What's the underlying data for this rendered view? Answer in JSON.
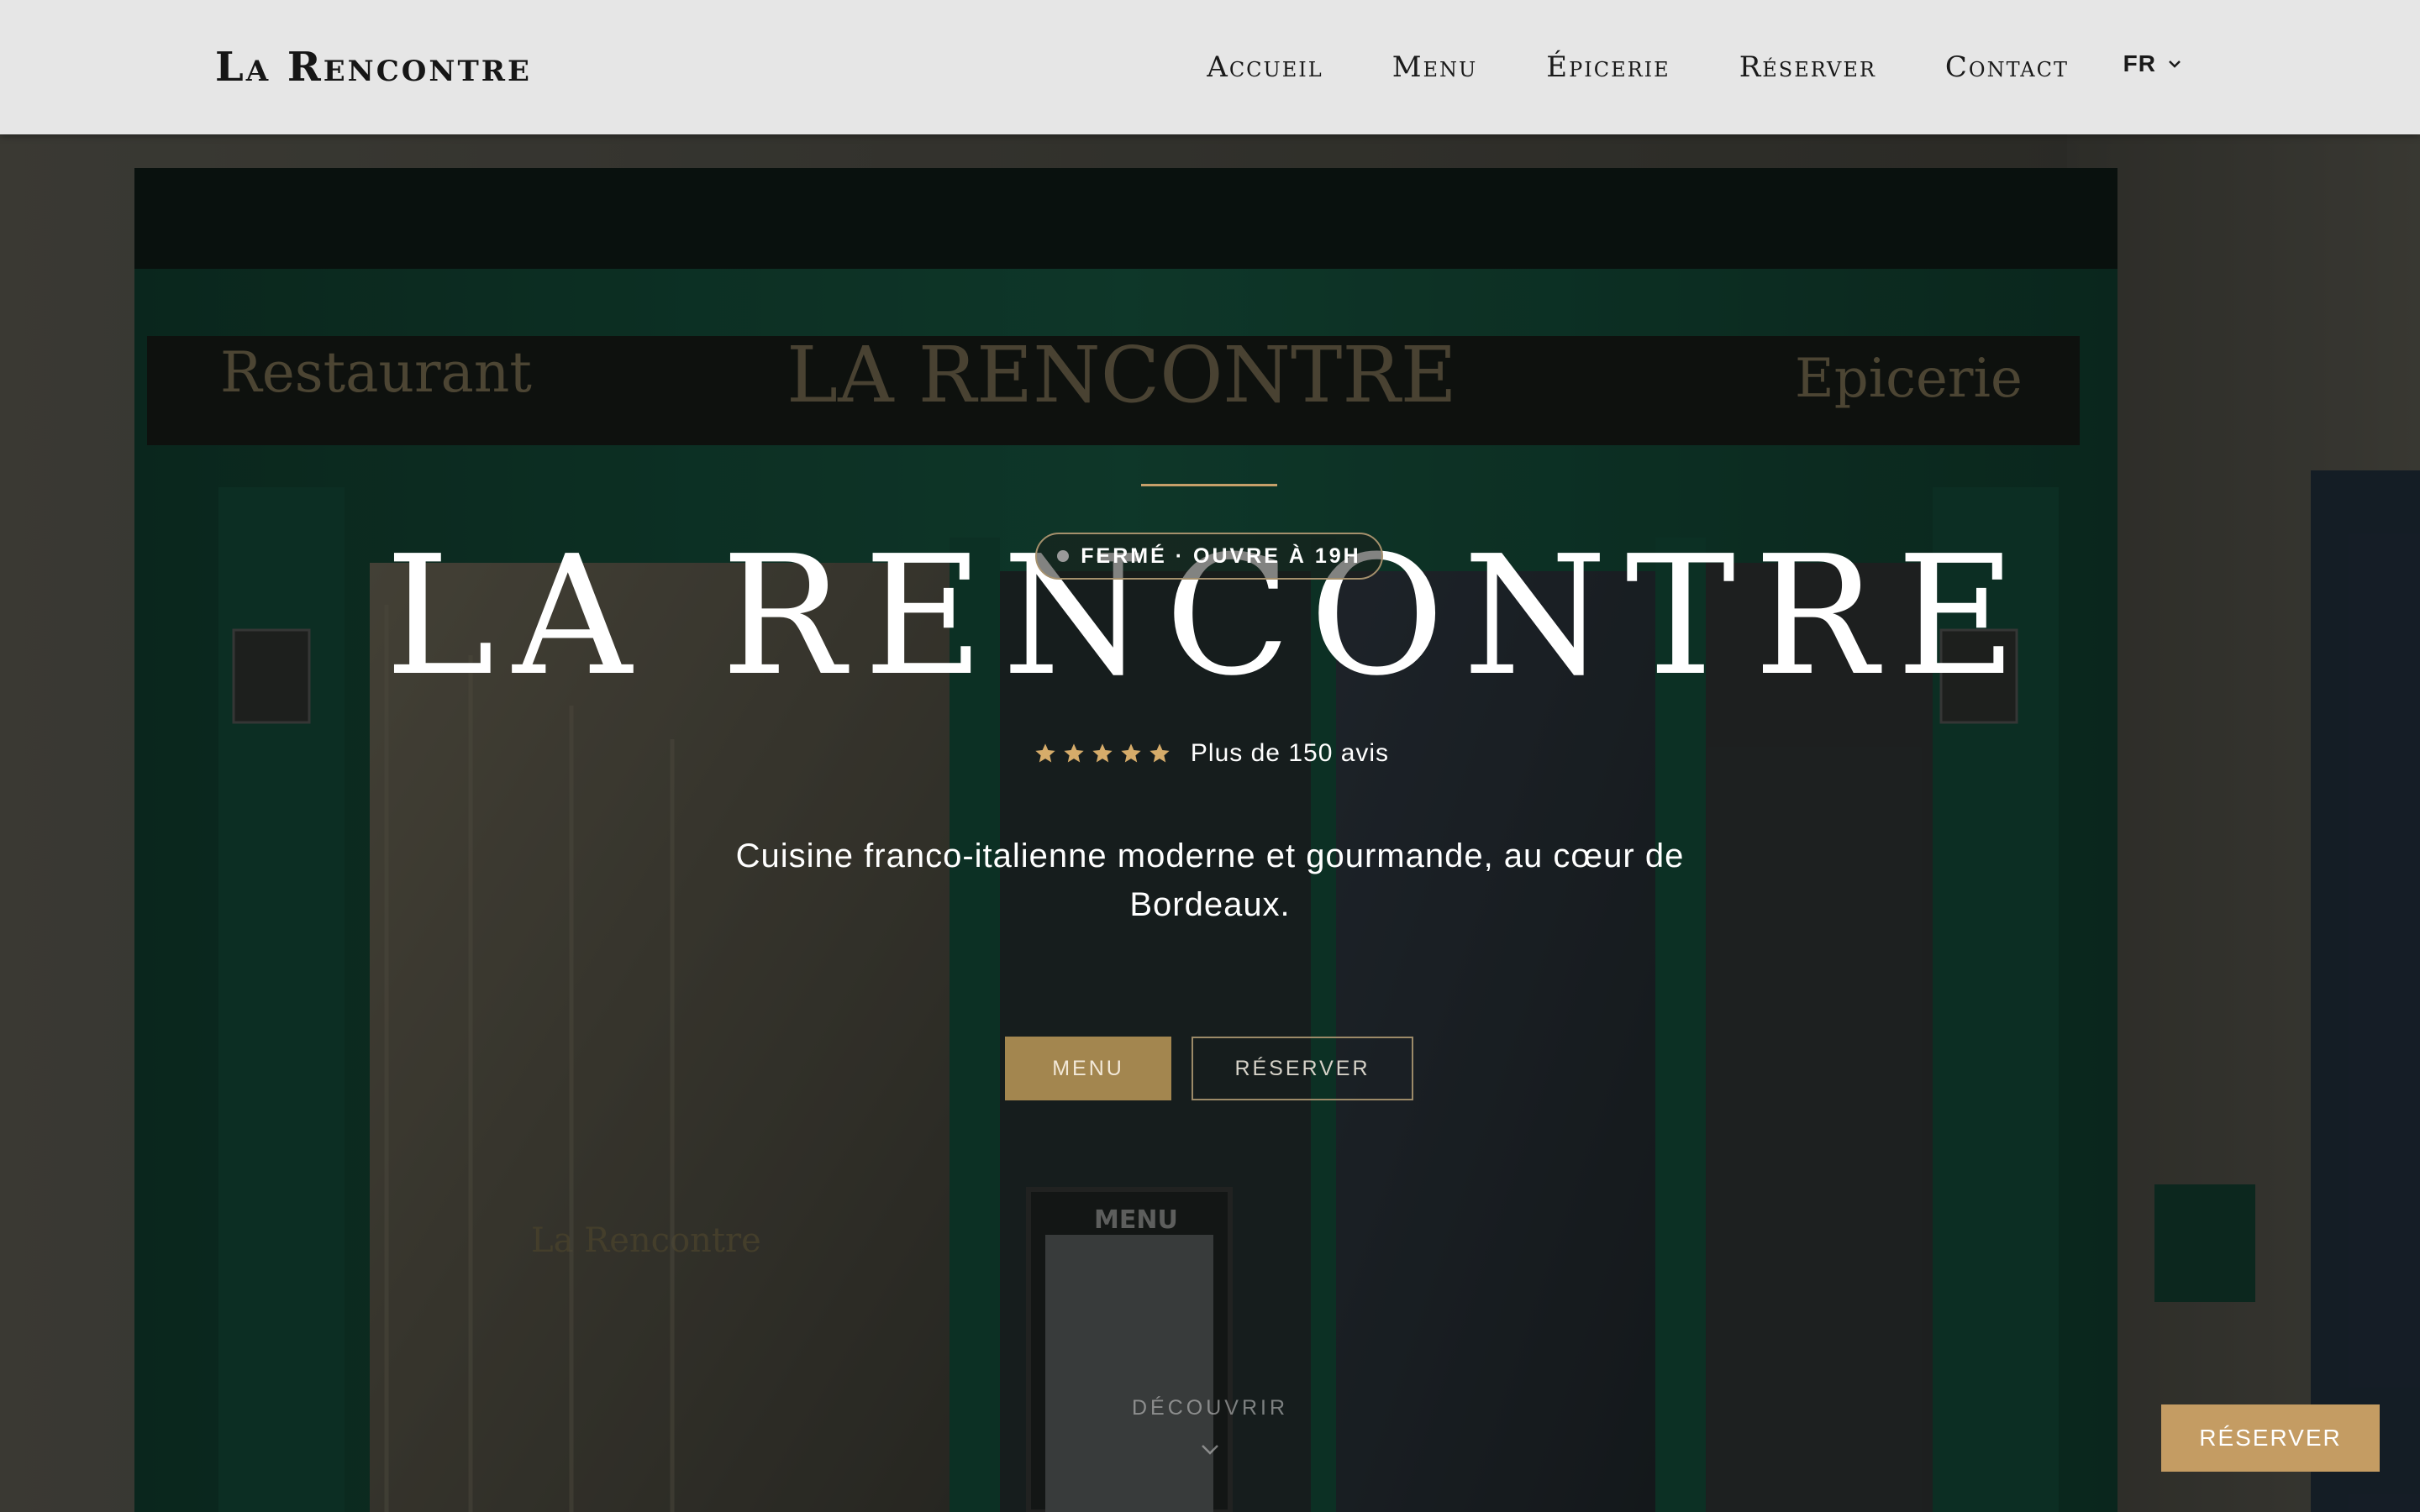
{
  "nav": {
    "brand": "La Rencontre",
    "links": [
      "Accueil",
      "Menu",
      "Épicerie",
      "Réserver",
      "Contact"
    ],
    "language": "FR"
  },
  "hero": {
    "background_signs": {
      "left": "Restaurant",
      "center": "LA RENCONTRE",
      "right": "Epicerie",
      "window": "La Rencontre",
      "board": "MENU"
    },
    "title": "LA RENCONTRE",
    "status": "FERMÉ · OUVRE À 19H",
    "rating": {
      "stars": 5,
      "text": "Plus de 150 avis"
    },
    "tagline_line1": "Cuisine franco-italienne moderne et gourmande, au cœur de",
    "tagline_line2": "Bordeaux.",
    "buttons": {
      "menu": "MENU",
      "reserve": "RÉSERVER"
    },
    "discover": "DÉCOUVRIR"
  },
  "floating_button": "RÉSERVER",
  "colors": {
    "accent_gold": "#c49c63",
    "shopfront_green": "#0f4f3a",
    "navbar_bg": "#e6e6e6"
  }
}
